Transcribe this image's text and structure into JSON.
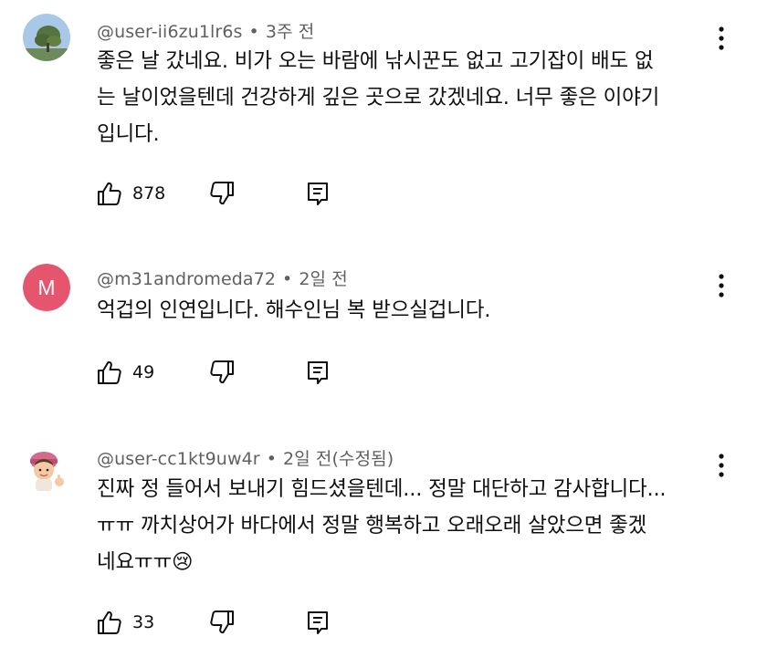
{
  "comments": [
    {
      "handle": "@user-ii6zu1lr6s",
      "time": "3주 전",
      "lines": [
        "좋은 날 갔네요. 비가 오는 바람에 낚시꾼도 없고 고기잡이 배도 없",
        "는 날이었을텐데 건강하게 깊은 곳으로 갔겠네요. 너무 좋은 이야기",
        "입니다."
      ],
      "likes": "878",
      "avatar": "tree-photo"
    },
    {
      "handle": "@m31andromeda72",
      "time": "2일 전",
      "lines": [
        "억겁의 인연입니다. 해수인님 복 받으실겁니다."
      ],
      "likes": "49",
      "avatar": "letter",
      "avatar_letter": "M",
      "avatar_color": "#e5566e"
    },
    {
      "handle": "@user-cc1kt9uw4r",
      "time": "2일 전(수정됨)",
      "lines": [
        "진짜 정 들어서 보내기 힘드셨을텐데... 정말 대단하고 감사합니다...",
        "ㅠㅠ 까치상어가 바다에서 정말 행복하고 오래오래 살았으면 좋겠",
        "네요ㅠㅠ"
      ],
      "emoji": "😢",
      "likes": "33",
      "avatar": "memoji"
    }
  ],
  "separator": "•",
  "icons": {
    "like": "thumbs-up-icon",
    "dislike": "thumbs-down-icon",
    "reply": "reply-comment-icon",
    "more": "more-vertical-icon"
  }
}
